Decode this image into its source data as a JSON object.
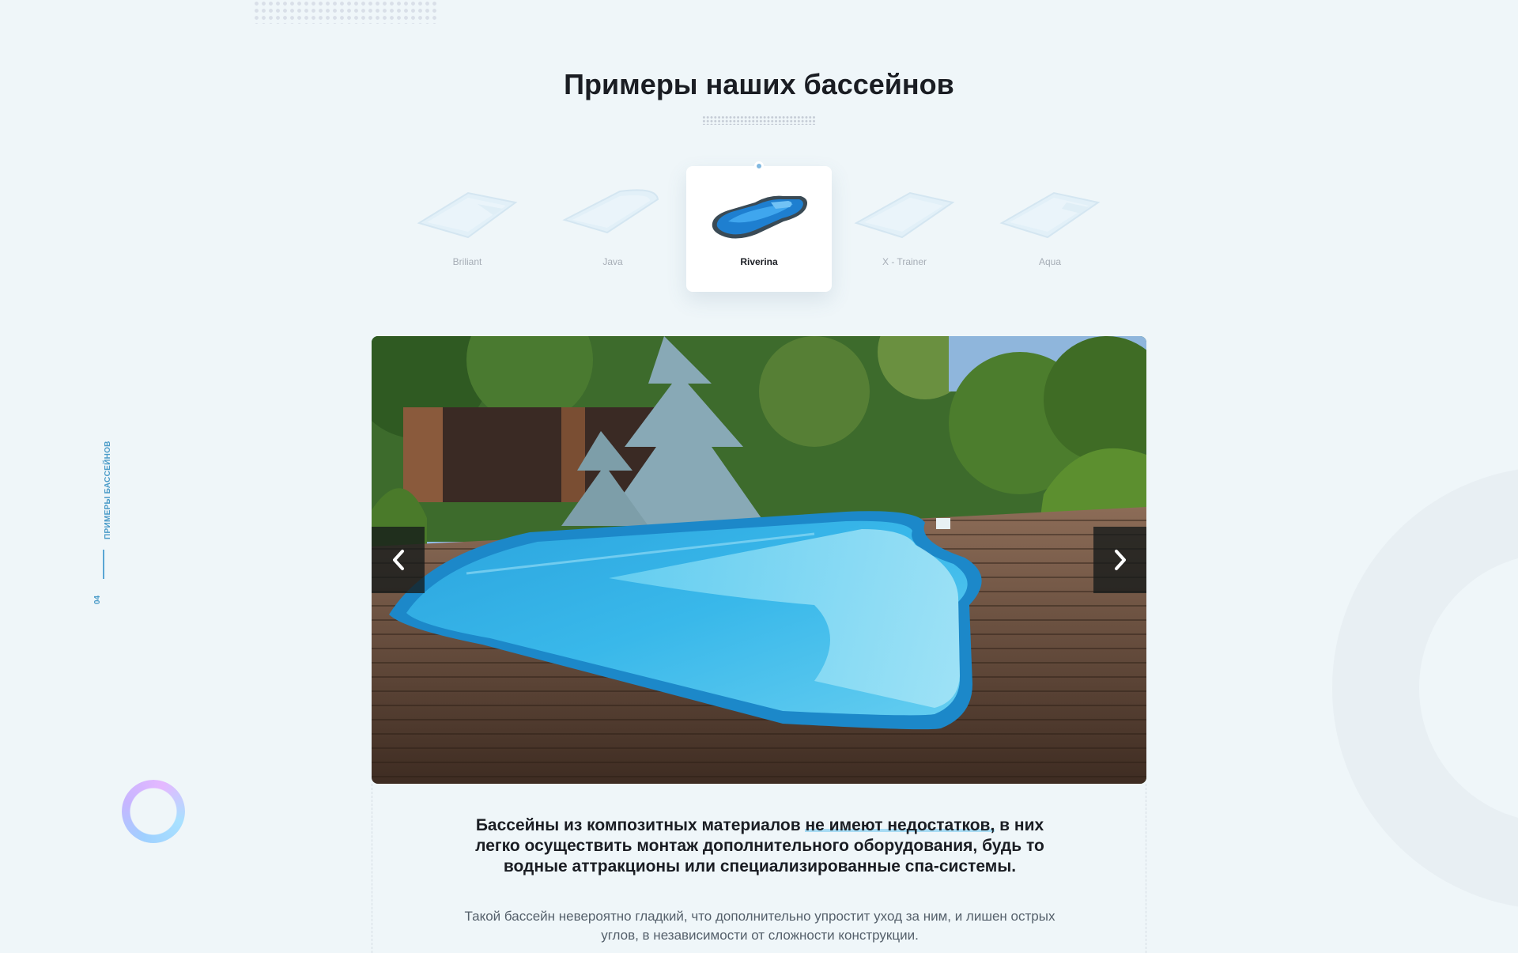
{
  "section": {
    "title": "Примеры наших бассейнов",
    "side_label": "Примеры бассейнов",
    "side_number": "04"
  },
  "models": [
    {
      "name": "Briliant",
      "active": false
    },
    {
      "name": "Java",
      "active": false
    },
    {
      "name": "Riverina",
      "active": true
    },
    {
      "name": "X - Trainer",
      "active": false
    },
    {
      "name": "Aqua",
      "active": false
    }
  ],
  "slider": {
    "image": "pool-photo",
    "prev_icon": "chevron-left-icon",
    "next_icon": "chevron-right-icon"
  },
  "description": {
    "lead_before": "Бассейны из композитных материалов ",
    "lead_highlight": "не имеют недостатков,",
    "lead_after": " в них легко осуществить монтаж дополнительного оборудования, будь то водные аттракционы или специализированные спа-системы.",
    "body": "Такой бассейн невероятно гладкий, что дополнительно упростит уход за ним, и лишен острых углов, в независимости от сложности конструкции."
  },
  "colors": {
    "background": "#eff6f9",
    "accent": "#4a9bc8",
    "highlight": "#a8dcf4"
  }
}
